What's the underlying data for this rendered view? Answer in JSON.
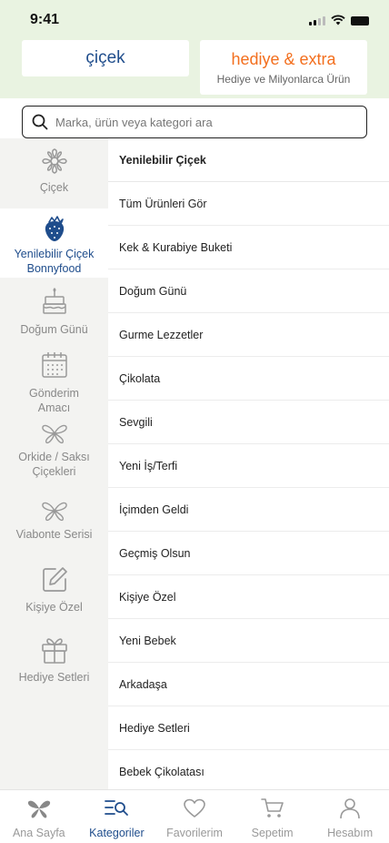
{
  "status_bar": {
    "time": "9:41"
  },
  "top_tabs": {
    "cicek": "çiçek",
    "hediye_title": "hediye & extra",
    "hediye_subtitle": "Hediye ve Milyonlarca Ürün"
  },
  "search": {
    "placeholder": "Marka, ürün veya kategori ara"
  },
  "rail": {
    "items": [
      {
        "label": "Çiçek",
        "icon": "flower-icon",
        "active": false
      },
      {
        "label": "Yenilebilir Çiçek Bonnyfood",
        "icon": "strawberry-icon",
        "active": true
      },
      {
        "label": "Doğum Günü",
        "icon": "cake-icon",
        "active": false
      },
      {
        "label": "Gönderim Amacı",
        "icon": "calendar-icon",
        "active": false
      },
      {
        "label": "Orkide / Saksı Çiçekleri",
        "icon": "orchid-icon",
        "active": false
      },
      {
        "label": "Viabonte Serisi",
        "icon": "butterfly-icon",
        "active": false
      },
      {
        "label": "Kişiye Özel",
        "icon": "edit-icon",
        "active": false
      },
      {
        "label": "Hediye Setleri",
        "icon": "gift-icon",
        "active": false
      }
    ]
  },
  "list": {
    "heading": "Yenilebilir Çiçek",
    "items": [
      "Tüm Ürünleri Gör",
      "Kek & Kurabiye Buketi",
      "Doğum Günü",
      "Gurme Lezzetler",
      "Çikolata",
      "Sevgili",
      "Yeni İş/Terfi",
      "İçimden Geldi",
      "Geçmiş Olsun",
      "Kişiye Özel",
      "Yeni Bebek",
      "Arkadaşa",
      "Hediye Setleri",
      "Bebek Çikolatası"
    ]
  },
  "bottom_nav": {
    "items": [
      {
        "label": "Ana Sayfa",
        "icon": "home-flower-icon",
        "active": false
      },
      {
        "label": "Kategoriler",
        "icon": "categories-icon",
        "active": true
      },
      {
        "label": "Favorilerim",
        "icon": "heart-icon",
        "active": false
      },
      {
        "label": "Sepetim",
        "icon": "cart-icon",
        "active": false
      },
      {
        "label": "Hesabım",
        "icon": "user-icon",
        "active": false
      }
    ]
  },
  "colors": {
    "accent": "#1f4d8c",
    "orange": "#f36f1e",
    "header_bg": "#e9f3e1",
    "rail_bg": "#f3f3f1"
  }
}
